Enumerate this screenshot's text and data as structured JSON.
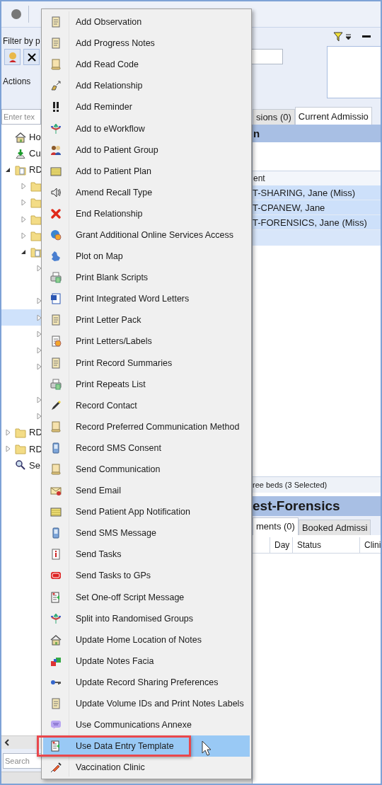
{
  "filter_panel": {
    "label": "Filter by p",
    "actions_label": "Actions"
  },
  "tree_search": {
    "placeholder": "Enter tex"
  },
  "top_tabs": [
    {
      "label": "sions (0)",
      "selected": false
    },
    {
      "label": "Current Admissio",
      "selected": true
    }
  ],
  "tree": [
    {
      "kind": "home",
      "label": "Ho",
      "selected": false
    },
    {
      "kind": "download",
      "label": "Cu",
      "selected": false
    },
    {
      "kind": "record",
      "label": "RD",
      "expanded": true,
      "selected": false,
      "children": [
        {
          "kind": "folder",
          "expanded": false,
          "selected": false
        },
        {
          "kind": "folder",
          "expanded": false,
          "selected": false
        },
        {
          "kind": "folder",
          "expanded": false,
          "selected": false
        },
        {
          "kind": "folder",
          "expanded": false,
          "selected": false
        },
        {
          "kind": "record",
          "expanded": true,
          "selected": false,
          "children": [
            {
              "kind": "node",
              "expanded": false,
              "selected": false
            },
            {
              "kind": "leaf",
              "selected": false
            },
            {
              "kind": "node",
              "expanded": false,
              "selected": false
            },
            {
              "kind": "node",
              "expanded": false,
              "selected": true
            },
            {
              "kind": "node",
              "expanded": false,
              "selected": false
            },
            {
              "kind": "node",
              "expanded": false,
              "selected": false
            },
            {
              "kind": "node",
              "expanded": false,
              "selected": false
            },
            {
              "kind": "leaf",
              "selected": false
            },
            {
              "kind": "node",
              "expanded": false,
              "selected": false
            },
            {
              "kind": "node",
              "expanded": false,
              "selected": false
            }
          ]
        }
      ]
    },
    {
      "kind": "folder",
      "label": "RD",
      "expanded": false,
      "selected": false
    },
    {
      "kind": "folder",
      "label": "RD",
      "expanded": false,
      "selected": false
    },
    {
      "kind": "search",
      "label": "Se",
      "selected": false
    }
  ],
  "bottom_search": {
    "placeholder": "Search"
  },
  "admissions": {
    "title": "n",
    "column": "ent",
    "rows": [
      {
        "patient": "T-SHARING, Jane (Miss)",
        "selected": true
      },
      {
        "patient": "T-CPANEW, Jane",
        "selected": true
      },
      {
        "patient": "T-FORENSICS, Jane (Miss)",
        "selected": true
      }
    ],
    "status": "ree beds (3 Selected)"
  },
  "clinic": {
    "title": "est-Forensics",
    "tabs": [
      {
        "label": "ments (0)",
        "selected": true
      },
      {
        "label": "Booked Admissi",
        "selected": false
      }
    ],
    "columns": [
      "Day",
      "Status",
      "Clini"
    ]
  },
  "context_menu": {
    "items": [
      {
        "label": "Add Observation",
        "selected": false
      },
      {
        "label": "Add Progress Notes",
        "selected": false
      },
      {
        "label": "Add Read Code",
        "selected": false
      },
      {
        "label": "Add Relationship",
        "selected": false
      },
      {
        "label": "Add Reminder",
        "selected": false
      },
      {
        "label": "Add to eWorkflow",
        "selected": false
      },
      {
        "label": "Add to Patient Group",
        "selected": false
      },
      {
        "label": "Add to Patient Plan",
        "selected": false
      },
      {
        "label": "Amend Recall Type",
        "selected": false
      },
      {
        "label": "End Relationship",
        "selected": false
      },
      {
        "label": "Grant Additional Online Services Access",
        "selected": false
      },
      {
        "label": "Plot on Map",
        "selected": false
      },
      {
        "label": "Print Blank Scripts",
        "selected": false
      },
      {
        "label": "Print Integrated Word Letters",
        "selected": false
      },
      {
        "label": "Print Letter Pack",
        "selected": false
      },
      {
        "label": "Print Letters/Labels",
        "selected": false
      },
      {
        "label": "Print Record Summaries",
        "selected": false
      },
      {
        "label": "Print Repeats List",
        "selected": false
      },
      {
        "label": "Record Contact",
        "selected": false
      },
      {
        "label": "Record Preferred Communication Method",
        "selected": false
      },
      {
        "label": "Record SMS Consent",
        "selected": false
      },
      {
        "label": "Send Communication",
        "selected": false
      },
      {
        "label": "Send Email",
        "selected": false
      },
      {
        "label": "Send Patient App Notification",
        "selected": false
      },
      {
        "label": "Send SMS Message",
        "selected": false
      },
      {
        "label": "Send Tasks",
        "selected": false
      },
      {
        "label": "Send Tasks to GPs",
        "selected": false
      },
      {
        "label": "Set One-off Script Message",
        "selected": false
      },
      {
        "label": "Split into Randomised Groups",
        "selected": false
      },
      {
        "label": "Update Home Location of Notes",
        "selected": false
      },
      {
        "label": "Update Notes Facia",
        "selected": false
      },
      {
        "label": "Update Record Sharing Preferences",
        "selected": false
      },
      {
        "label": "Update Volume IDs and Print Notes Labels",
        "selected": false
      },
      {
        "label": "Use Communications Annexe",
        "selected": false
      },
      {
        "label": "Use Data Entry Template",
        "selected": true
      },
      {
        "label": "Vaccination Clinic",
        "selected": false
      }
    ]
  }
}
